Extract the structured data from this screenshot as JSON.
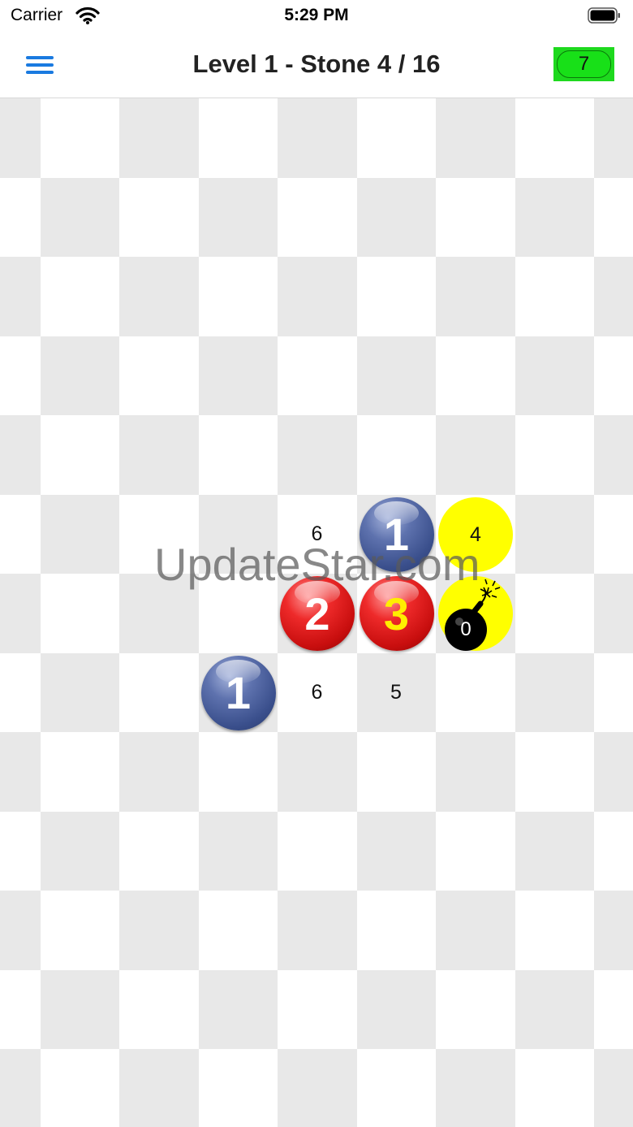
{
  "status_bar": {
    "carrier": "Carrier",
    "time": "5:29 PM"
  },
  "header": {
    "title": "Level 1 - Stone 4 / 16",
    "score": "7",
    "score_color": "#1ed91e",
    "menu_icon": "hamburger-menu-icon"
  },
  "board": {
    "columns": 8,
    "rows": 13,
    "tile_light": "#ffffff",
    "tile_dark": "#e8e8e8",
    "hints": [
      {
        "row": 5,
        "col": 4,
        "text": "6"
      },
      {
        "row": 7,
        "col": 4,
        "text": "6"
      },
      {
        "row": 7,
        "col": 5,
        "text": "5"
      }
    ],
    "balls": [
      {
        "row": 5,
        "col": 5,
        "color": "blue",
        "label": "1"
      },
      {
        "row": 6,
        "col": 4,
        "color": "red",
        "label": "2"
      },
      {
        "row": 6,
        "col": 5,
        "color": "red",
        "label": "3",
        "label_color": "yellow"
      },
      {
        "row": 7,
        "col": 3,
        "color": "blue",
        "label": "1"
      }
    ],
    "yellow_cells": [
      {
        "row": 5,
        "col": 6,
        "text": "4"
      },
      {
        "row": 6,
        "col": 6,
        "text": "",
        "bomb": true,
        "bomb_count": "0"
      }
    ]
  },
  "watermark": "UpdateStar.com"
}
